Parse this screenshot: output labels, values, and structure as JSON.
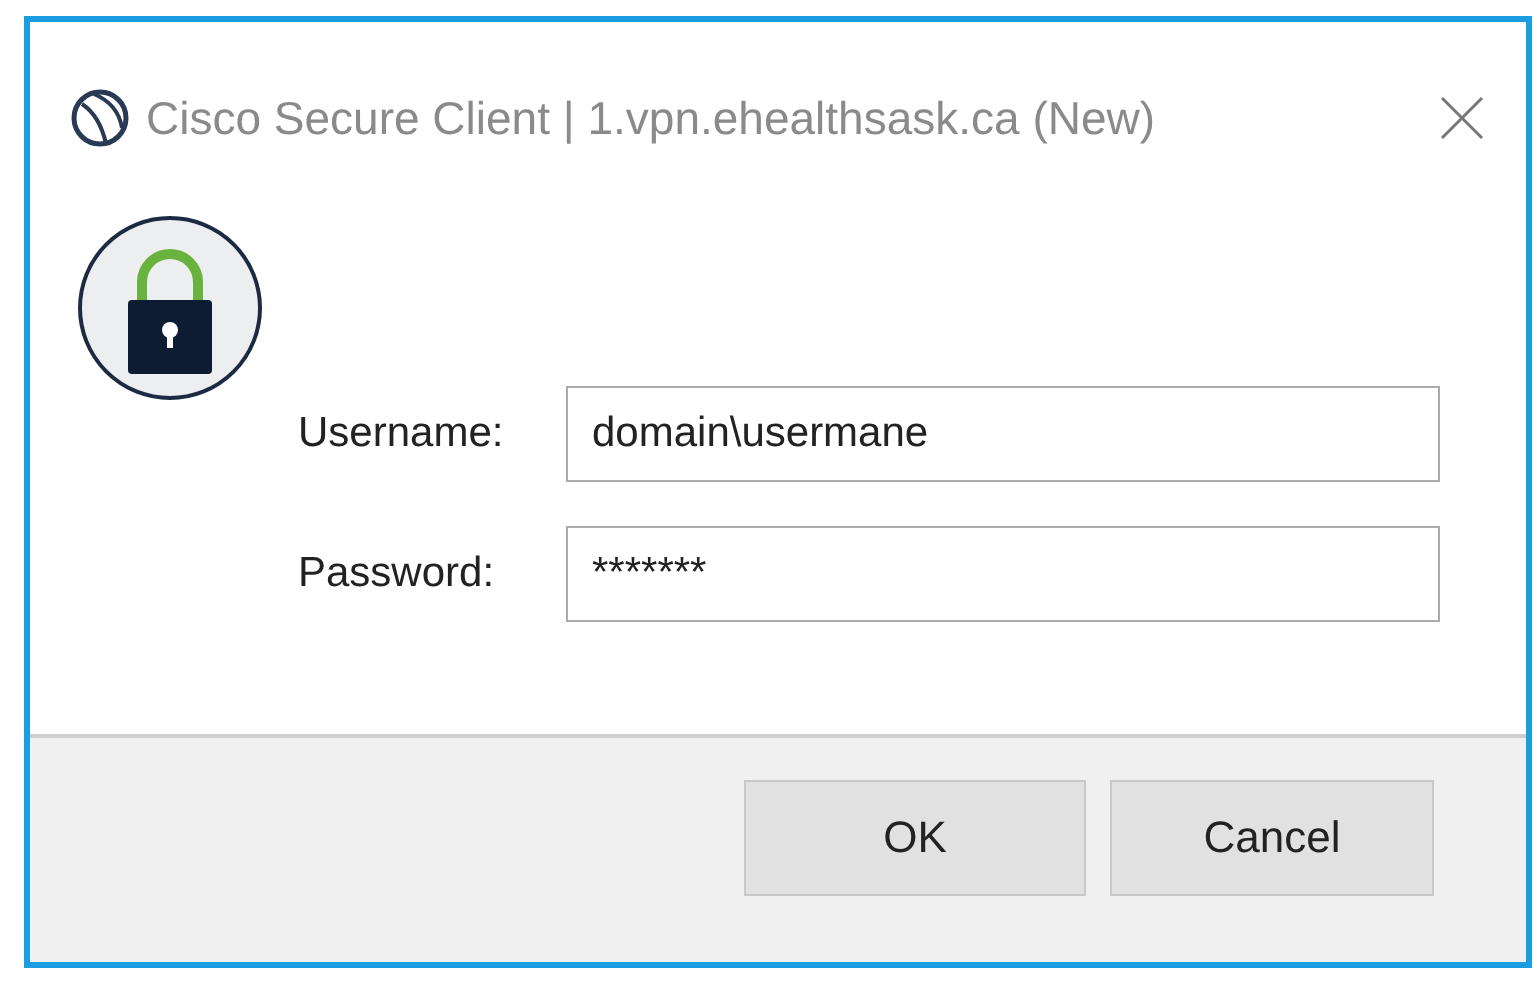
{
  "window": {
    "title": "Cisco Secure Client | 1.vpn.ehealthsask.ca (New)"
  },
  "fields": [
    {
      "label": "Username:",
      "value": "domain\\usermane"
    },
    {
      "label": "Password:",
      "value": "*******"
    }
  ],
  "buttons": [
    "OK",
    "Cancel"
  ]
}
